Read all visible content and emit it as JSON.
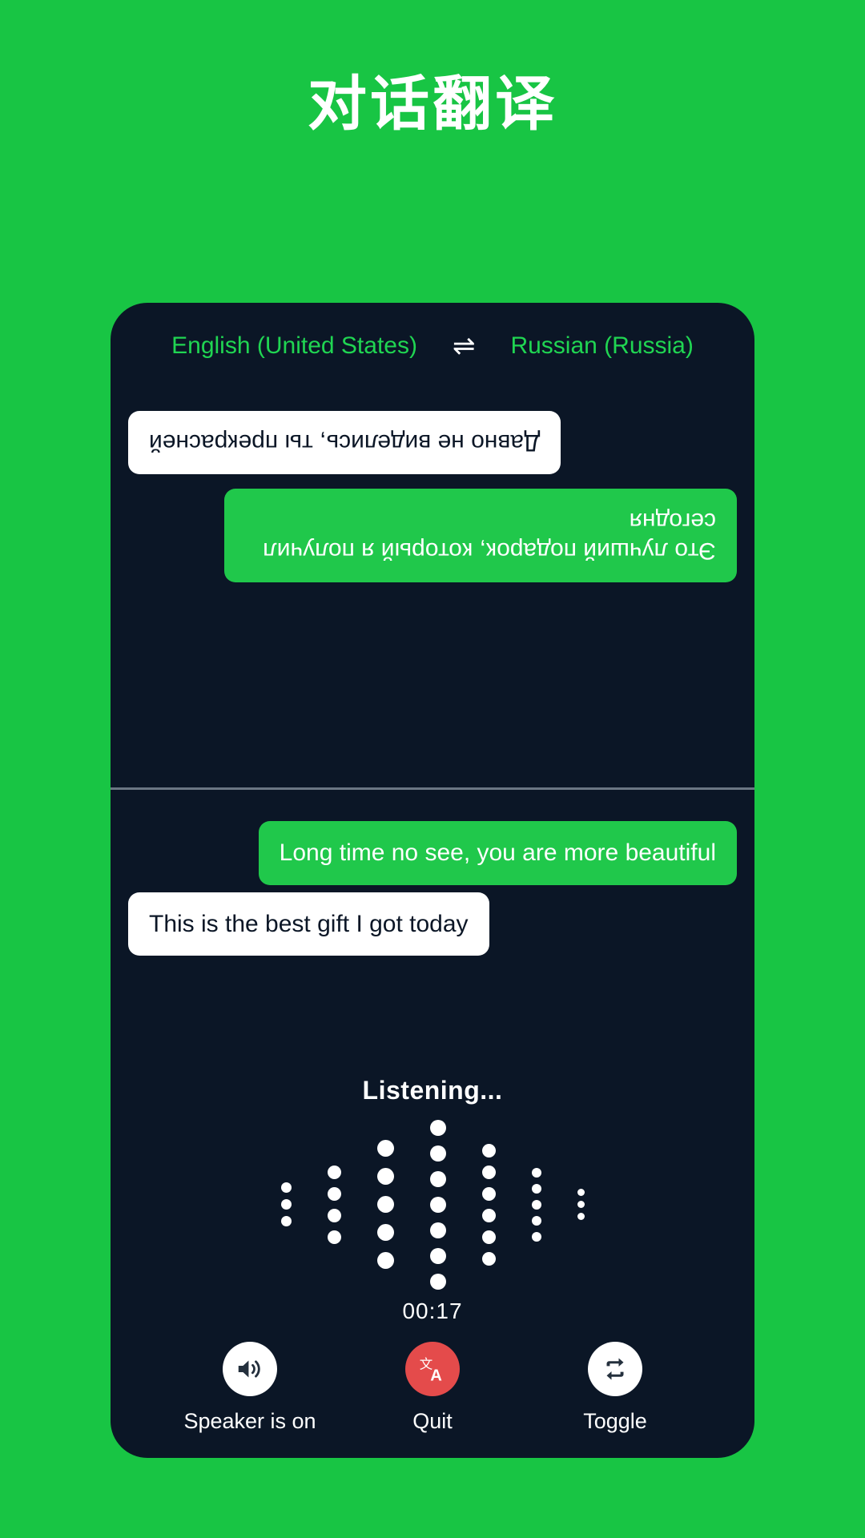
{
  "page": {
    "title": "对话翻译",
    "background_color": "#18c544",
    "card_color": "#0b1626",
    "accent_color": "#20c84b",
    "danger_color": "#e44b4b"
  },
  "languages": {
    "source": "English (United States)",
    "target": "Russian (Russia)",
    "swap_glyph": "⇌",
    "swap_icon_name": "swap-languages-icon"
  },
  "remote_pane": {
    "rotated": true,
    "messages": [
      {
        "text": "Это лучший подарок, который я получил сегодня",
        "style": "accent",
        "align": "left"
      },
      {
        "text": "Давно не виделись, ты прекрасней",
        "style": "plain",
        "align": "right"
      }
    ]
  },
  "local_pane": {
    "messages": [
      {
        "text": "Long time no see, you are more beautiful",
        "style": "accent",
        "align": "right"
      },
      {
        "text": "This is the best gift I got today",
        "style": "plain",
        "align": "left"
      }
    ]
  },
  "listening": {
    "label": "Listening...",
    "timer": "00:17",
    "waveform": {
      "columns": [
        {
          "dots": 3,
          "size": 13
        },
        {
          "dots": 4,
          "size": 17
        },
        {
          "dots": 5,
          "size": 21
        },
        {
          "dots": 7,
          "size": 20
        },
        {
          "dots": 6,
          "size": 17
        },
        {
          "dots": 5,
          "size": 12
        },
        {
          "dots": 3,
          "size": 9
        }
      ]
    }
  },
  "controls": [
    {
      "label": "Speaker is on",
      "icon": "speaker-on-icon",
      "style": "light",
      "name": "speaker-button"
    },
    {
      "label": "Quit",
      "icon": "translate-icon",
      "style": "danger",
      "name": "quit-button"
    },
    {
      "label": "Toggle",
      "icon": "toggle-repeat-icon",
      "style": "light",
      "name": "toggle-button"
    }
  ]
}
